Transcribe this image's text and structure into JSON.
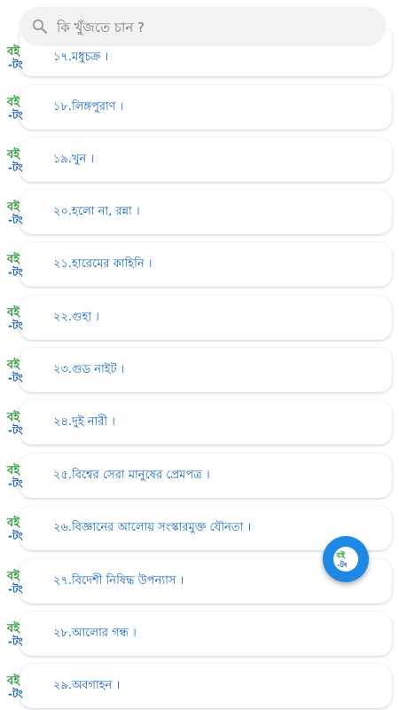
{
  "search": {
    "placeholder": "কি খুঁজতে চান ?"
  },
  "brand": {
    "primary_color": "#1565c0",
    "logo_green": "#2e9e3e",
    "logo_blue": "#1e5fbf",
    "fab_color": "#1e88e5"
  },
  "list": {
    "items": [
      {
        "label": "১৭.মধুচক্র ।"
      },
      {
        "label": "১৮.লিঙ্গপুরাণ ।"
      },
      {
        "label": "১৯.খুন ।"
      },
      {
        "label": "২০.হলো না, রন্না ।"
      },
      {
        "label": "২১.হারেমের কাহিনি ।"
      },
      {
        "label": "২২.গুহা ।"
      },
      {
        "label": "২৩.গুড নাইট ।"
      },
      {
        "label": "২৪.দুই নারী ।"
      },
      {
        "label": "২৫.বিশ্বের সেরা মানুষের প্রেমপত্র ।"
      },
      {
        "label": "২৬.বিজ্ঞানের আলোয় সংস্কারমুক্ত যৌনতা ।"
      },
      {
        "label": "২৭.বিদেশী নিষিদ্ধ উপন্যাস ।"
      },
      {
        "label": "২৮.আলোর গন্ধ ।"
      },
      {
        "label": "২৯.অবগাহন ।"
      }
    ]
  },
  "icons": {
    "search": "search-icon",
    "logo": "boi-tong-logo-icon",
    "fab": "boi-tong-logo-icon"
  }
}
